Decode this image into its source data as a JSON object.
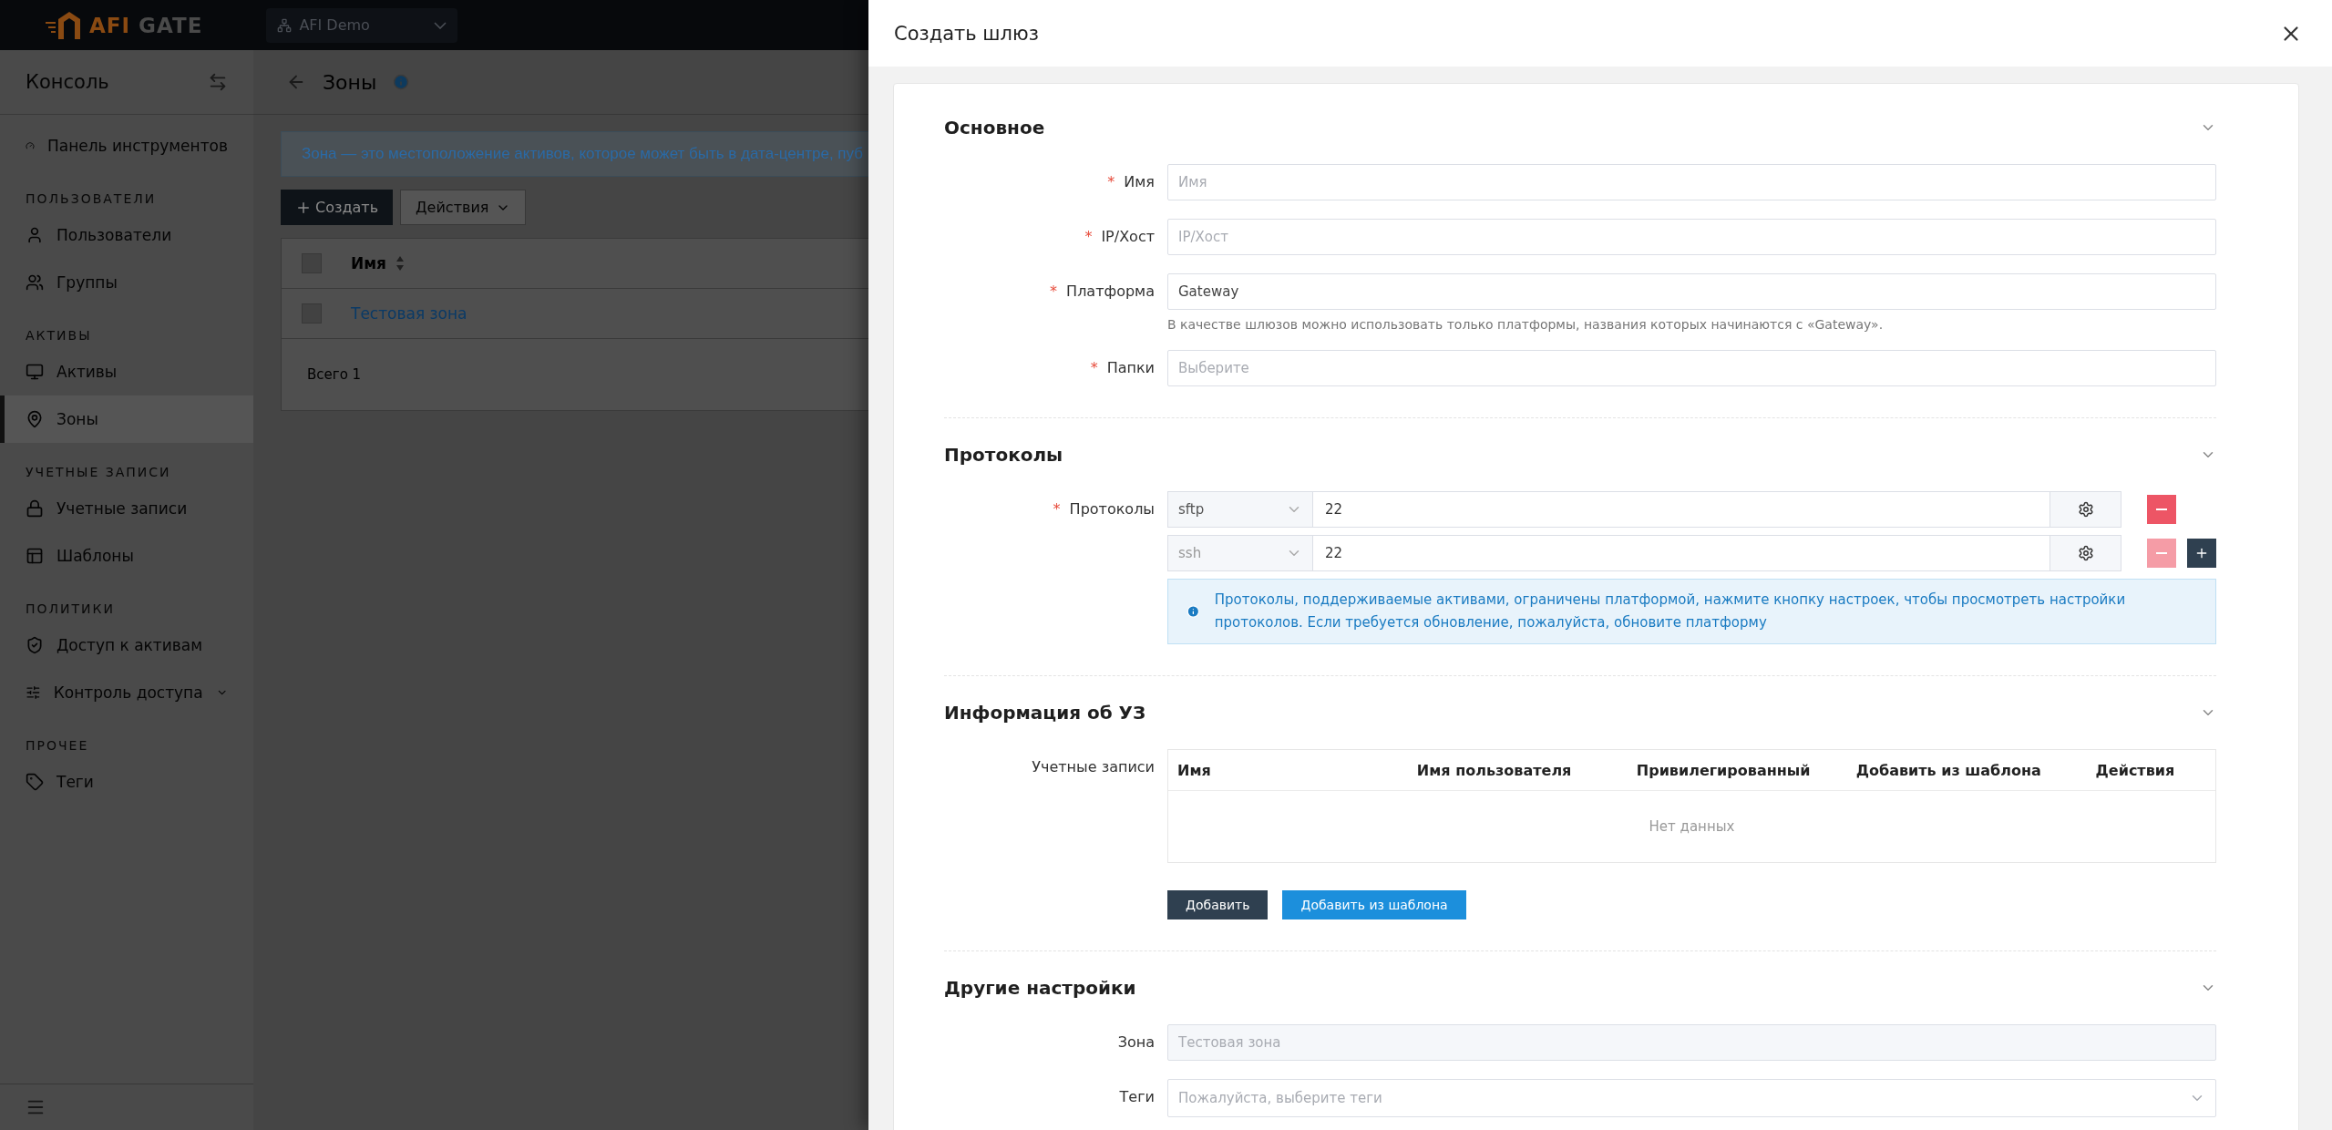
{
  "topbar": {
    "logo": {
      "accent": "AFI",
      "rest": "GATE"
    },
    "org_selector": "AFI Demo"
  },
  "sidebar": {
    "title": "Консоль",
    "groups": [
      {
        "items": [
          {
            "label": "Панель инструментов",
            "kind": "link",
            "selected": false
          }
        ]
      },
      {
        "heading": "ПОЛЬЗОВАТЕЛИ",
        "items": [
          {
            "label": "Пользователи",
            "kind": "link",
            "selected": false
          },
          {
            "label": "Группы",
            "kind": "link",
            "selected": false
          }
        ]
      },
      {
        "heading": "АКТИВЫ",
        "items": [
          {
            "label": "Активы",
            "kind": "link",
            "selected": false
          },
          {
            "label": "Зоны",
            "kind": "link",
            "selected": true
          }
        ]
      },
      {
        "heading": "УЧЕТНЫЕ ЗАПИСИ",
        "items": [
          {
            "label": "Учетные записи",
            "kind": "link",
            "selected": false
          },
          {
            "label": "Шаблоны",
            "kind": "link",
            "selected": false
          }
        ]
      },
      {
        "heading": "ПОЛИТИКИ",
        "items": [
          {
            "label": "Доступ к активам",
            "kind": "link",
            "selected": false
          },
          {
            "label": "Контроль доступа",
            "kind": "submenu",
            "selected": false
          }
        ]
      },
      {
        "heading": "ПРОЧЕЕ",
        "items": [
          {
            "label": "Теги",
            "kind": "link",
            "selected": false
          }
        ]
      }
    ]
  },
  "page": {
    "title": "Зоны",
    "banner": "Зона — это местоположение активов, которое может быть в дата-центре, пуб",
    "buttons": [
      "Создать",
      "Действия"
    ],
    "table": {
      "columns": [
        "Имя"
      ],
      "all_checked": false,
      "rows": [
        {
          "name": "Тестовая зона",
          "checked": false
        }
      ],
      "total": "Всего 1"
    }
  },
  "drawer": {
    "title": "Создать шлюз",
    "required_mark": "*",
    "sections": [
      {
        "title": "Основное",
        "expanded": true,
        "fields": [
          {
            "kind": "input",
            "label": "Имя",
            "required": true,
            "placeholder": "Имя"
          },
          {
            "kind": "input",
            "label": "IP/Хост",
            "required": true,
            "placeholder": "IP/Хост"
          },
          {
            "kind": "input",
            "label": "Платформа",
            "required": true,
            "value": "Gateway",
            "help": "В качестве шлюзов можно использовать только платформы, названия которых начинаются с «Gateway»."
          },
          {
            "kind": "input",
            "label": "Папки",
            "required": true,
            "placeholder": "Выберите"
          }
        ]
      },
      {
        "title": "Протоколы",
        "expanded": true,
        "fields": [
          {
            "kind": "protocols",
            "label": "Протоколы",
            "required": true,
            "rows": [
              {
                "protocol": "sftp",
                "port": "22",
                "disabled": false
              },
              {
                "protocol": "ssh",
                "port": "22",
                "disabled": true
              }
            ],
            "note": "Протоколы, поддерживаемые активами, ограничены платформой, нажмите кнопку настроек, чтобы просмотреть настройки протоколов. Если требуется обновление, пожалуйста, обновите платформу"
          }
        ]
      },
      {
        "title": "Информация об УЗ",
        "expanded": true,
        "fields": [
          {
            "kind": "accounts",
            "label": "Учетные записи",
            "required": false,
            "columns": [
              "Имя",
              "Имя пользователя",
              "Привилегированный",
              "Добавить из шаблона",
              "Действия"
            ],
            "empty": "Нет данных",
            "buttons": [
              "Добавить",
              "Добавить из шаблона"
            ]
          }
        ]
      },
      {
        "title": "Другие настройки",
        "expanded": true,
        "fields": [
          {
            "kind": "input",
            "label": "Зона",
            "required": false,
            "value": "Тестовая зона",
            "disabled": true
          },
          {
            "kind": "select",
            "label": "Теги",
            "required": false,
            "placeholder": "Пожалуйста, выберите теги"
          }
        ]
      }
    ]
  }
}
